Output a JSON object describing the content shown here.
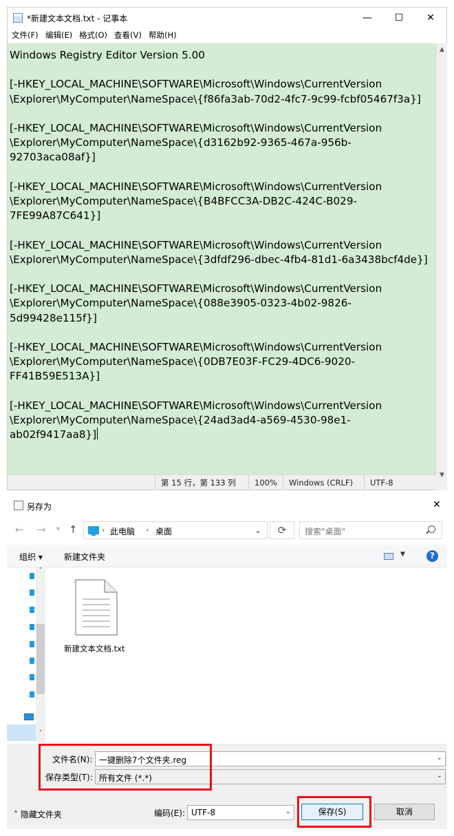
{
  "notepad": {
    "title": "*新建文本文档.txt - 记事本",
    "window_buttons": {
      "minimize": "—",
      "maximize": "☐",
      "close": "✕"
    },
    "menu": [
      "文件(F)",
      "编辑(E)",
      "格式(O)",
      "查看(V)",
      "帮助(H)"
    ],
    "lines": [
      "Windows Registry Editor Version 5.00",
      "",
      "[-HKEY_LOCAL_MACHINE\\SOFTWARE\\Microsoft\\Windows\\CurrentVersion",
      "\\Explorer\\MyComputer\\NameSpace\\{f86fa3ab-70d2-4fc7-9c99-fcbf05467f3a}]",
      "",
      "[-HKEY_LOCAL_MACHINE\\SOFTWARE\\Microsoft\\Windows\\CurrentVersion",
      "\\Explorer\\MyComputer\\NameSpace\\{d3162b92-9365-467a-956b-",
      "92703aca08af}]",
      "",
      "[-HKEY_LOCAL_MACHINE\\SOFTWARE\\Microsoft\\Windows\\CurrentVersion",
      "\\Explorer\\MyComputer\\NameSpace\\{B4BFCC3A-DB2C-424C-B029-",
      "7FE99A87C641}]",
      "",
      "[-HKEY_LOCAL_MACHINE\\SOFTWARE\\Microsoft\\Windows\\CurrentVersion",
      "\\Explorer\\MyComputer\\NameSpace\\{3dfdf296-dbec-4fb4-81d1-6a3438bcf4de}]",
      "",
      "[-HKEY_LOCAL_MACHINE\\SOFTWARE\\Microsoft\\Windows\\CurrentVersion",
      "\\Explorer\\MyComputer\\NameSpace\\{088e3905-0323-4b02-9826-",
      "5d99428e115f}]",
      "",
      "[-HKEY_LOCAL_MACHINE\\SOFTWARE\\Microsoft\\Windows\\CurrentVersion",
      "\\Explorer\\MyComputer\\NameSpace\\{0DB7E03F-FC29-4DC6-9020-",
      "FF41B59E513A}]",
      "",
      "[-HKEY_LOCAL_MACHINE\\SOFTWARE\\Microsoft\\Windows\\CurrentVersion",
      "\\Explorer\\MyComputer\\NameSpace\\{24ad3ad4-a569-4530-98e1-",
      "ab02f9417aa8}]"
    ],
    "status": {
      "position": "第 15 行，第 133 列",
      "zoom": "100%",
      "line_ending": "Windows (CRLF)",
      "encoding": "UTF-8"
    },
    "editor_bg": "#d3ecd3"
  },
  "save_dialog": {
    "title": "另存为",
    "close": "✕",
    "nav": {
      "back": "←",
      "forward": "→",
      "up": "↑"
    },
    "breadcrumb": [
      "此电脑",
      "桌面"
    ],
    "breadcrumb_sep": "›",
    "refresh": "⟳",
    "search_placeholder": "搜索\"桌面\"",
    "toolbar": {
      "organize": "组织 ▾",
      "new_folder": "新建文件夹",
      "help": "?"
    },
    "file": {
      "name": "新建文本文档.txt"
    },
    "filename_label": "文件名(N):",
    "filename_value": "一键删除7个文件夹.reg",
    "filetype_label": "保存类型(T):",
    "filetype_value": "所有文件  (*.*)",
    "hide_folders": "隐藏文件夹",
    "encoding_label": "编码(E):",
    "encoding_value": "UTF-8",
    "save_button": "保存(S)",
    "cancel_button": "取消",
    "highlight_color": "#e8101a"
  }
}
